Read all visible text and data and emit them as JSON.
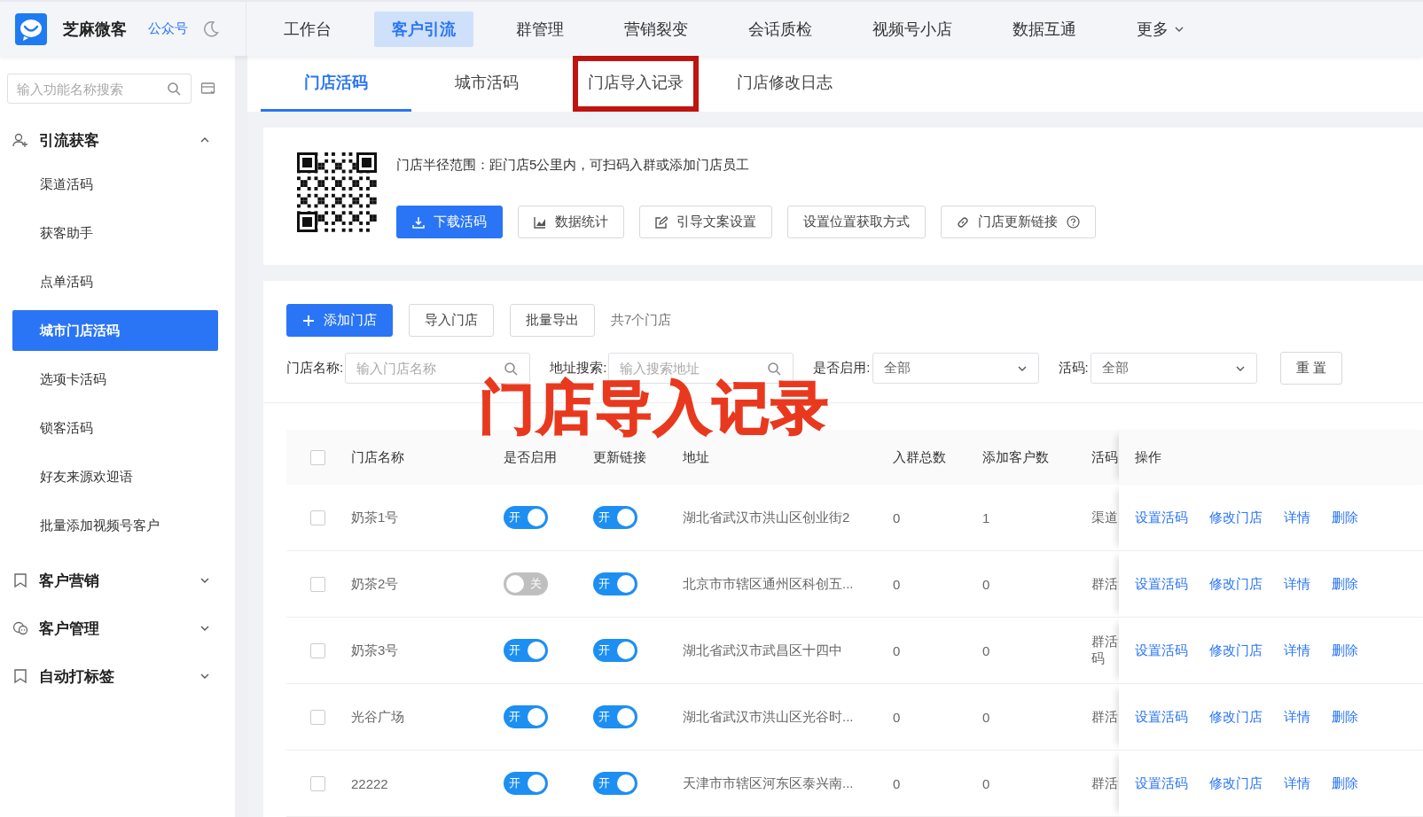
{
  "brand": {
    "name": "芝麻微客",
    "account": "公众号"
  },
  "nav": [
    {
      "label": "工作台",
      "selected": false,
      "kind": "plain"
    },
    {
      "label": "客户引流",
      "selected": true,
      "kind": "plain"
    },
    {
      "label": "群管理",
      "selected": false,
      "kind": "plain"
    },
    {
      "label": "营销裂变",
      "selected": false,
      "kind": "plain"
    },
    {
      "label": "会话质检",
      "selected": false,
      "kind": "plain"
    },
    {
      "label": "视频号小店",
      "selected": false,
      "kind": "plain"
    },
    {
      "label": "数据互通",
      "selected": false,
      "kind": "plain"
    },
    {
      "label": "更多",
      "selected": false,
      "kind": "dropdown"
    }
  ],
  "sidebar": {
    "search": {
      "placeholder": "输入功能名称搜索"
    },
    "groups": [
      {
        "label": "引流获客",
        "kind": "user",
        "expanded": true,
        "children": [
          {
            "label": "渠道活码",
            "selected": false
          },
          {
            "label": "获客助手",
            "selected": false
          },
          {
            "label": "点单活码",
            "selected": false
          },
          {
            "label": "城市门店活码",
            "selected": true
          },
          {
            "label": "选项卡活码",
            "selected": false
          },
          {
            "label": "锁客活码",
            "selected": false
          },
          {
            "label": "好友来源欢迎语",
            "selected": false
          },
          {
            "label": "批量添加视频号客户",
            "selected": false
          }
        ]
      },
      {
        "label": "客户营销",
        "kind": "bookmark",
        "expanded": false
      },
      {
        "label": "客户管理",
        "kind": "chat",
        "expanded": false
      },
      {
        "label": "自动打标签",
        "kind": "bookmark",
        "expanded": false
      }
    ]
  },
  "tabs": [
    {
      "label": "门店活码",
      "selected": true,
      "marked": false
    },
    {
      "label": "城市活码",
      "selected": false,
      "marked": false
    },
    {
      "label": "门店导入记录",
      "selected": false,
      "marked": true
    },
    {
      "label": "门店修改日志",
      "selected": false,
      "marked": false
    }
  ],
  "annotation": {
    "text": "门店导入记录"
  },
  "qr_card": {
    "description": "门店半径范围：距门店5公里内，可扫码入群或添加门店员工",
    "buttons": [
      {
        "label": "下载活码",
        "kind": "download"
      },
      {
        "label": "数据统计",
        "kind": "chart"
      },
      {
        "label": "引导文案设置",
        "kind": "edit"
      },
      {
        "label": "设置位置获取方式",
        "kind": "plain"
      },
      {
        "label": "门店更新链接",
        "kind": "link"
      }
    ]
  },
  "toolbar": {
    "buttons": [
      {
        "label": "添加门店",
        "kind": "add"
      },
      {
        "label": "导入门店",
        "kind": "plain"
      },
      {
        "label": "批量导出",
        "kind": "plain"
      }
    ],
    "count": "共7个门店"
  },
  "filters": [
    {
      "label": "门店名称:",
      "kind": "search",
      "placeholder": "输入门店名称"
    },
    {
      "label": "地址搜索:",
      "kind": "search",
      "placeholder": "输入搜索地址"
    },
    {
      "label": "是否启用:",
      "kind": "select",
      "value": "全部"
    },
    {
      "label": "活码:",
      "kind": "select",
      "value": "全部"
    }
  ],
  "reset_button": "重 置",
  "table": {
    "all_checked": false,
    "columns": [
      "门店名称",
      "是否启用",
      "更新链接",
      "地址",
      "入群总数",
      "添加客户数",
      "活码",
      "操作"
    ],
    "rows": [
      {
        "checked": false,
        "name": "奶茶1号",
        "enabled": {
          "on": true,
          "label": "开"
        },
        "update_link": {
          "on": true,
          "label": "开"
        },
        "address": "湖北省武汉市洪山区创业街2",
        "group_total": "0",
        "customers": "1",
        "code": "渠道",
        "actions": [
          "设置活码",
          "修改门店",
          "详情",
          "删除"
        ]
      },
      {
        "checked": false,
        "name": "奶茶2号",
        "enabled": {
          "on": false,
          "label": "关"
        },
        "update_link": {
          "on": true,
          "label": "开"
        },
        "address": "北京市市辖区通州区科创五...",
        "group_total": "0",
        "customers": "0",
        "code": "群活",
        "actions": [
          "设置活码",
          "修改门店",
          "详情",
          "删除"
        ]
      },
      {
        "checked": false,
        "name": "奶茶3号",
        "enabled": {
          "on": true,
          "label": "开"
        },
        "update_link": {
          "on": true,
          "label": "开"
        },
        "address": "湖北省武汉市武昌区十四中",
        "group_total": "0",
        "customers": "0",
        "code": "群活码",
        "actions": [
          "设置活码",
          "修改门店",
          "详情",
          "删除"
        ]
      },
      {
        "checked": false,
        "name": "光谷广场",
        "enabled": {
          "on": true,
          "label": "开"
        },
        "update_link": {
          "on": true,
          "label": "开"
        },
        "address": "湖北省武汉市洪山区光谷时...",
        "group_total": "0",
        "customers": "0",
        "code": "群活",
        "actions": [
          "设置活码",
          "修改门店",
          "详情",
          "删除"
        ]
      },
      {
        "checked": false,
        "name": "22222",
        "enabled": {
          "on": true,
          "label": "开"
        },
        "update_link": {
          "on": true,
          "label": "开"
        },
        "address": "天津市市辖区河东区泰兴南...",
        "group_total": "0",
        "customers": "0",
        "code": "群活",
        "actions": [
          "设置活码",
          "修改门店",
          "详情",
          "删除"
        ]
      }
    ]
  }
}
